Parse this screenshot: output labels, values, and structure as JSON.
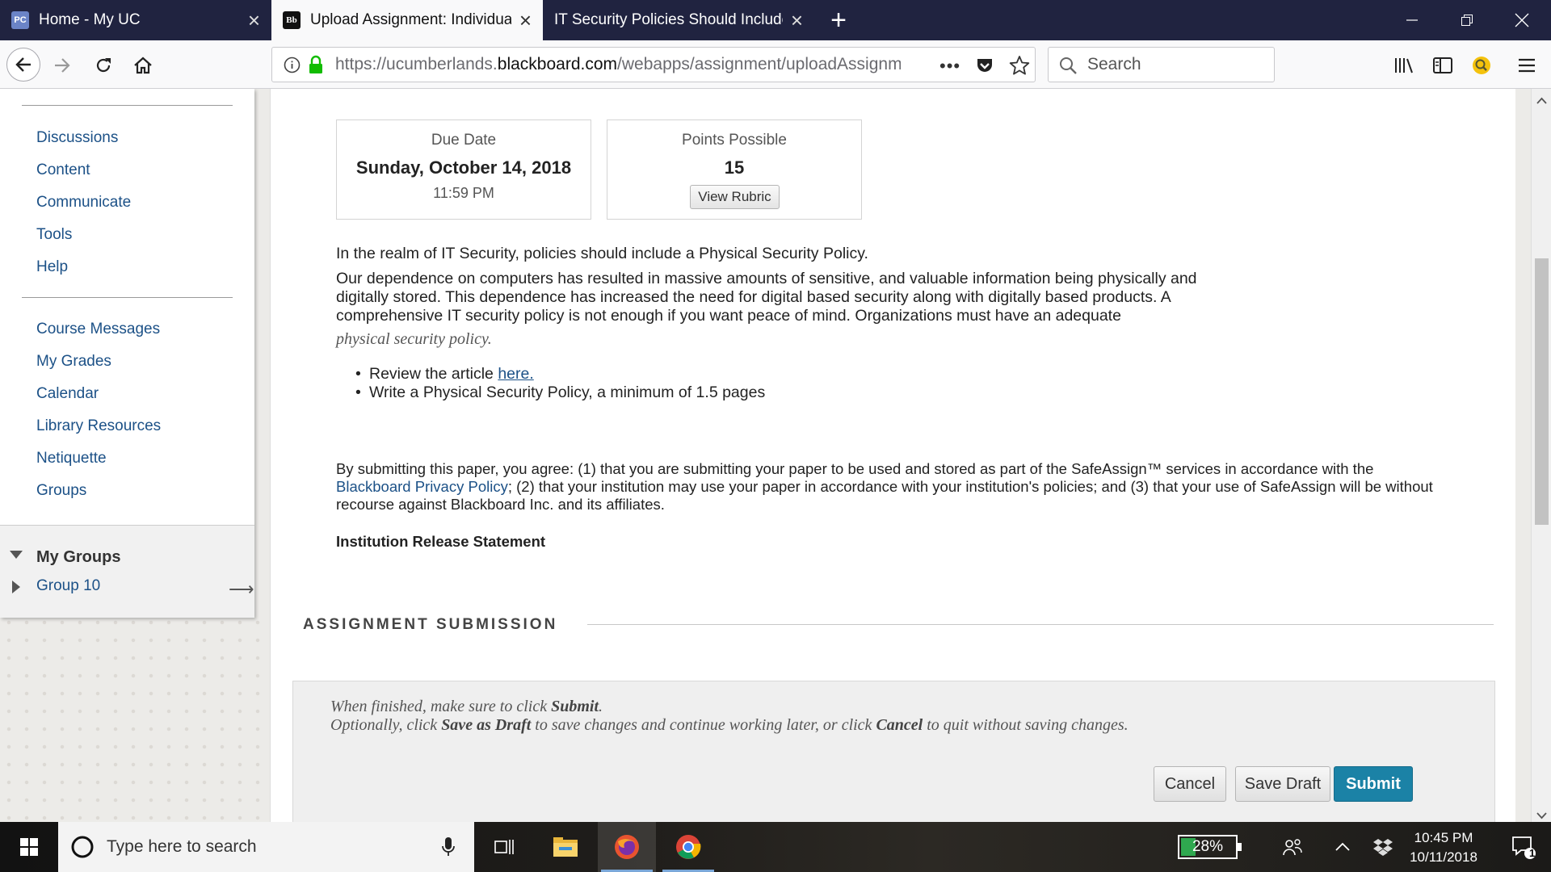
{
  "browser": {
    "tabs": [
      {
        "title": "Home - My UC",
        "favicon": "PC",
        "active": false
      },
      {
        "title": "Upload Assignment: Individual",
        "favicon": "Bb",
        "active": true
      },
      {
        "title": "IT Security Policies Should Include a",
        "favicon": "",
        "active": false
      }
    ],
    "url_prefix": "https://ucumberlands.",
    "url_domain": "blackboard.com",
    "url_suffix": "/webapps/assignment/uploadAssignm",
    "search_placeholder": "Search"
  },
  "sidebar": {
    "section1": [
      "Discussions",
      "Content",
      "Communicate",
      "Tools",
      "Help"
    ],
    "section2": [
      "Course Messages",
      "My Grades",
      "Calendar",
      "Library Resources",
      "Netiquette",
      "Groups"
    ],
    "my_groups": {
      "title": "My Groups",
      "items": [
        "Group 10"
      ]
    }
  },
  "assignment": {
    "due": {
      "label": "Due Date",
      "date": "Sunday, October 14, 2018",
      "time": "11:59 PM"
    },
    "points": {
      "label": "Points Possible",
      "value": "15",
      "rubric_button": "View Rubric"
    },
    "intro": "In the realm of IT Security, policies should include a Physical Security Policy.",
    "paragraph_lines": [
      "Our dependence on computers has resulted in massive amounts of sensitive, and valuable information being physically and",
      "digitally stored.  This dependence has increased the need for digital based security along with digitally based products. A",
      "comprehensive IT security policy is not enough if you want peace of mind. Organizations must have an adequate"
    ],
    "paragraph_end": "physical security policy",
    "paragraph_end_period": ".",
    "bullet1_text": "Review the article ",
    "bullet1_link": "here.",
    "bullet2_text": "Write a Physical Security Policy, a minimum of 1.5 pages"
  },
  "agreement": {
    "part1": "By submitting this paper, you agree: (1) that you are submitting your paper to be used and stored as part of the SafeAssign™ services in accordance with the",
    "link": "Blackboard Privacy Policy",
    "part2": "; (2) that your institution may use your paper in accordance with your institution's policies; and (3) that your use of SafeAssign will be without recourse against Blackboard Inc. and its affiliates."
  },
  "release_statement": "Institution Release Statement",
  "submission": {
    "section_title": "ASSIGNMENT SUBMISSION",
    "line1_pre": "When finished, make sure to click ",
    "line1_bold": "Submit",
    "line1_post": ".",
    "line2_pre": "Optionally, click ",
    "line2_bold1": "Save as Draft",
    "line2_mid": " to save changes and continue working later, or click ",
    "line2_bold2": "Cancel",
    "line2_post": " to quit without saving changes.",
    "buttons": {
      "cancel": "Cancel",
      "save_draft": "Save Draft",
      "submit": "Submit"
    }
  },
  "taskbar": {
    "search_placeholder": "Type here to search",
    "battery": "28%",
    "battery_level": 0.28,
    "time": "10:45 PM",
    "date": "10/11/2018",
    "notification_count": "1"
  },
  "colors": {
    "link": "#1c5187",
    "submit": "#1b82a6",
    "tabbar": "#202340"
  }
}
